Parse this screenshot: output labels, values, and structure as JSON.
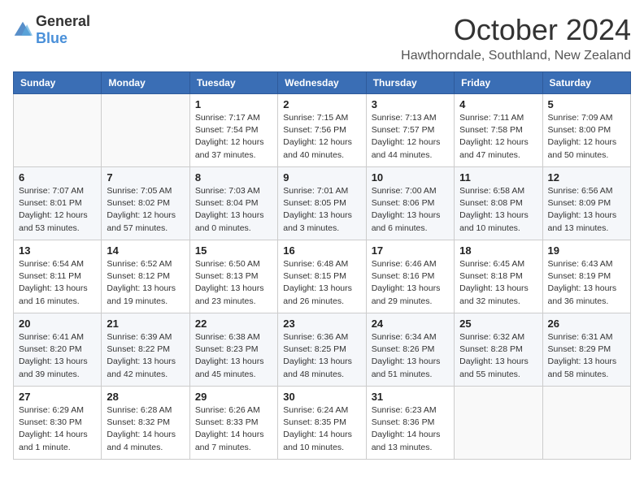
{
  "logo": {
    "general": "General",
    "blue": "Blue"
  },
  "header": {
    "month": "October 2024",
    "location": "Hawthorndale, Southland, New Zealand"
  },
  "weekdays": [
    "Sunday",
    "Monday",
    "Tuesday",
    "Wednesday",
    "Thursday",
    "Friday",
    "Saturday"
  ],
  "weeks": [
    [
      {
        "day": "",
        "info": ""
      },
      {
        "day": "",
        "info": ""
      },
      {
        "day": "1",
        "info": "Sunrise: 7:17 AM\nSunset: 7:54 PM\nDaylight: 12 hours\nand 37 minutes."
      },
      {
        "day": "2",
        "info": "Sunrise: 7:15 AM\nSunset: 7:56 PM\nDaylight: 12 hours\nand 40 minutes."
      },
      {
        "day": "3",
        "info": "Sunrise: 7:13 AM\nSunset: 7:57 PM\nDaylight: 12 hours\nand 44 minutes."
      },
      {
        "day": "4",
        "info": "Sunrise: 7:11 AM\nSunset: 7:58 PM\nDaylight: 12 hours\nand 47 minutes."
      },
      {
        "day": "5",
        "info": "Sunrise: 7:09 AM\nSunset: 8:00 PM\nDaylight: 12 hours\nand 50 minutes."
      }
    ],
    [
      {
        "day": "6",
        "info": "Sunrise: 7:07 AM\nSunset: 8:01 PM\nDaylight: 12 hours\nand 53 minutes."
      },
      {
        "day": "7",
        "info": "Sunrise: 7:05 AM\nSunset: 8:02 PM\nDaylight: 12 hours\nand 57 minutes."
      },
      {
        "day": "8",
        "info": "Sunrise: 7:03 AM\nSunset: 8:04 PM\nDaylight: 13 hours\nand 0 minutes."
      },
      {
        "day": "9",
        "info": "Sunrise: 7:01 AM\nSunset: 8:05 PM\nDaylight: 13 hours\nand 3 minutes."
      },
      {
        "day": "10",
        "info": "Sunrise: 7:00 AM\nSunset: 8:06 PM\nDaylight: 13 hours\nand 6 minutes."
      },
      {
        "day": "11",
        "info": "Sunrise: 6:58 AM\nSunset: 8:08 PM\nDaylight: 13 hours\nand 10 minutes."
      },
      {
        "day": "12",
        "info": "Sunrise: 6:56 AM\nSunset: 8:09 PM\nDaylight: 13 hours\nand 13 minutes."
      }
    ],
    [
      {
        "day": "13",
        "info": "Sunrise: 6:54 AM\nSunset: 8:11 PM\nDaylight: 13 hours\nand 16 minutes."
      },
      {
        "day": "14",
        "info": "Sunrise: 6:52 AM\nSunset: 8:12 PM\nDaylight: 13 hours\nand 19 minutes."
      },
      {
        "day": "15",
        "info": "Sunrise: 6:50 AM\nSunset: 8:13 PM\nDaylight: 13 hours\nand 23 minutes."
      },
      {
        "day": "16",
        "info": "Sunrise: 6:48 AM\nSunset: 8:15 PM\nDaylight: 13 hours\nand 26 minutes."
      },
      {
        "day": "17",
        "info": "Sunrise: 6:46 AM\nSunset: 8:16 PM\nDaylight: 13 hours\nand 29 minutes."
      },
      {
        "day": "18",
        "info": "Sunrise: 6:45 AM\nSunset: 8:18 PM\nDaylight: 13 hours\nand 32 minutes."
      },
      {
        "day": "19",
        "info": "Sunrise: 6:43 AM\nSunset: 8:19 PM\nDaylight: 13 hours\nand 36 minutes."
      }
    ],
    [
      {
        "day": "20",
        "info": "Sunrise: 6:41 AM\nSunset: 8:20 PM\nDaylight: 13 hours\nand 39 minutes."
      },
      {
        "day": "21",
        "info": "Sunrise: 6:39 AM\nSunset: 8:22 PM\nDaylight: 13 hours\nand 42 minutes."
      },
      {
        "day": "22",
        "info": "Sunrise: 6:38 AM\nSunset: 8:23 PM\nDaylight: 13 hours\nand 45 minutes."
      },
      {
        "day": "23",
        "info": "Sunrise: 6:36 AM\nSunset: 8:25 PM\nDaylight: 13 hours\nand 48 minutes."
      },
      {
        "day": "24",
        "info": "Sunrise: 6:34 AM\nSunset: 8:26 PM\nDaylight: 13 hours\nand 51 minutes."
      },
      {
        "day": "25",
        "info": "Sunrise: 6:32 AM\nSunset: 8:28 PM\nDaylight: 13 hours\nand 55 minutes."
      },
      {
        "day": "26",
        "info": "Sunrise: 6:31 AM\nSunset: 8:29 PM\nDaylight: 13 hours\nand 58 minutes."
      }
    ],
    [
      {
        "day": "27",
        "info": "Sunrise: 6:29 AM\nSunset: 8:30 PM\nDaylight: 14 hours\nand 1 minute."
      },
      {
        "day": "28",
        "info": "Sunrise: 6:28 AM\nSunset: 8:32 PM\nDaylight: 14 hours\nand 4 minutes."
      },
      {
        "day": "29",
        "info": "Sunrise: 6:26 AM\nSunset: 8:33 PM\nDaylight: 14 hours\nand 7 minutes."
      },
      {
        "day": "30",
        "info": "Sunrise: 6:24 AM\nSunset: 8:35 PM\nDaylight: 14 hours\nand 10 minutes."
      },
      {
        "day": "31",
        "info": "Sunrise: 6:23 AM\nSunset: 8:36 PM\nDaylight: 14 hours\nand 13 minutes."
      },
      {
        "day": "",
        "info": ""
      },
      {
        "day": "",
        "info": ""
      }
    ]
  ]
}
